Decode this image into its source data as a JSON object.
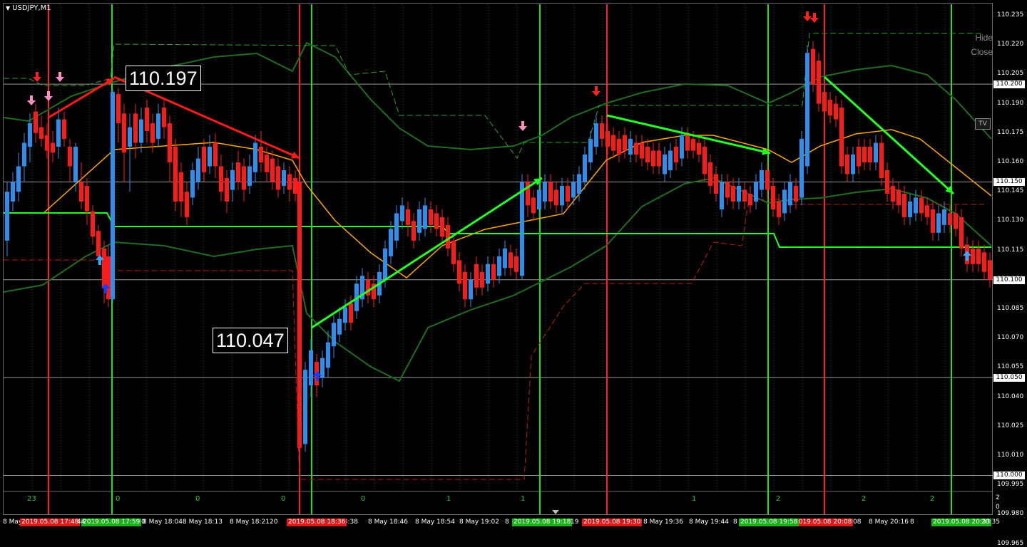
{
  "window": {
    "title": "USDJPY,M1",
    "hide_label": "Hide",
    "close_label": "Close",
    "tv_label": "TV"
  },
  "annotations": {
    "high_label": "110.197",
    "low_label": "110.047"
  },
  "price_axis": {
    "labels": [
      "110.235",
      "110.220",
      "110.205",
      "110.190",
      "110.175",
      "110.160",
      "110.145",
      "110.130",
      "110.115",
      "110.100",
      "110.085",
      "110.070",
      "110.055",
      "110.040",
      "110.025",
      "110.010",
      "109.995",
      "109.980",
      "109.965"
    ],
    "boxed": [
      "110.200",
      "110.150",
      "110.100",
      "110.050",
      "110.000"
    ]
  },
  "sub_window": {
    "scale_top": "2",
    "scale_bottom": "0",
    "counters": [
      "23",
      "0",
      "0",
      "0",
      "0",
      "1",
      "1",
      "1",
      "2",
      "2",
      "2"
    ]
  },
  "time_axis": {
    "labels": [
      "8 May",
      "8 May 18:04",
      "8 May 18:13",
      "8 May 18:21",
      "18:38",
      "8 May 18:46",
      "8 May 18:54",
      "8 May 19:02",
      "8",
      "8 May 19:36",
      "8 May 19:44",
      "8",
      "8 May 20:16",
      "8"
    ],
    "red_boxes": [
      "2019.05.08 17:48",
      "2019.05.08 18:36",
      "2019.05.08 19:30",
      "2019.05.08 20:08"
    ],
    "green_boxes": [
      "2019.05.08 17:59",
      "2019.05.08 19:18",
      "2019.05.08 19:58",
      "2019.05.08 20:33"
    ],
    "extra": [
      "44",
      "0",
      "19",
      "20",
      "20:35",
      "08"
    ]
  },
  "colors": {
    "background": "#000000",
    "bull_candle": "#2b8ff0",
    "bear_candle": "#ff1a1a",
    "ma_line": "#ffa500",
    "band_line": "#1e6e1e",
    "trend_red": "#ff1a1a",
    "trend_green": "#22ff22",
    "vline_red": "#ff2020",
    "vline_green": "#22e022",
    "level_line": "#22ff22"
  }
}
